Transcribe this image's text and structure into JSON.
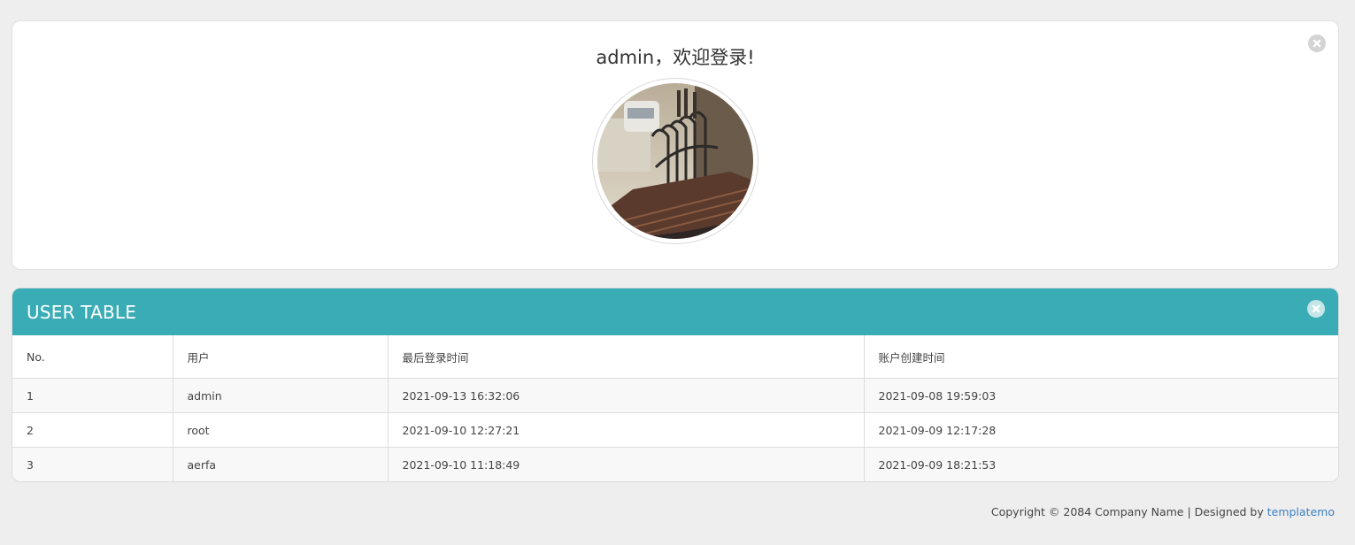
{
  "welcome": {
    "title": "admin，欢迎登录!",
    "close_icon": "close-circle-icon"
  },
  "user_table": {
    "title": "USER TABLE",
    "close_icon": "close-circle-icon",
    "columns": [
      "No.",
      "用户",
      "最后登录时间",
      "账户创建时间"
    ],
    "rows": [
      [
        "1",
        "admin",
        "2021-09-13 16:32:06",
        "2021-09-08 19:59:03"
      ],
      [
        "2",
        "root",
        "2021-09-10 12:27:21",
        "2021-09-09 12:17:28"
      ],
      [
        "3",
        "aerfa",
        "2021-09-10 11:18:49",
        "2021-09-09 18:21:53"
      ]
    ]
  },
  "footer": {
    "copyright": "Copyright © 2084 Company Name | Designed by ",
    "link_text": "templatemo"
  },
  "colors": {
    "page_bg": "#eeeeee",
    "header_teal": "#3aacb5",
    "link_blue": "#3a7fc1"
  }
}
